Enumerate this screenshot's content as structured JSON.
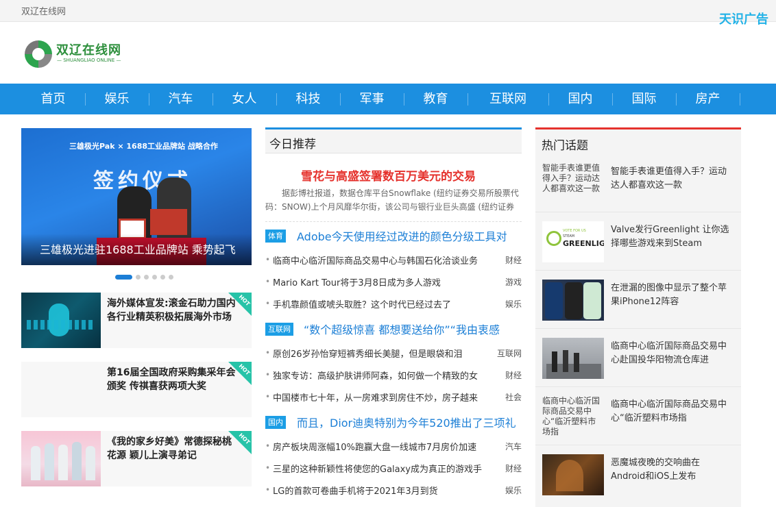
{
  "topbar": {
    "site_name": "双辽在线网",
    "ad_label": "天识广告"
  },
  "logo": {
    "name": "双辽在线网",
    "sub": "— SHUANGLIAO ONLINE —"
  },
  "nav": [
    "首页",
    "娱乐",
    "汽车",
    "女人",
    "科技",
    "军事",
    "教育",
    "互联网",
    "国内",
    "国际",
    "房产"
  ],
  "slider": {
    "caption": "三雄极光进驻1688工业品牌站 乘势起飞",
    "banner_text": "三雄极光Pak × 1688工业品牌站 战略合作",
    "banner_big": "签约仪式",
    "dot_count": 6,
    "active_dot": 0
  },
  "cards": [
    {
      "title": "海外媒体宣发:滚金石助力国内各行业精英积极拓展海外市场",
      "badge": "HOT"
    },
    {
      "title": "第16届全国政府采购集采年会颁奖 传祺喜获两项大奖",
      "badge": "HOT"
    },
    {
      "title": "《我的家乡好美》常德探秘桃花源 颖儿上演寻弟记",
      "badge": "HOT"
    }
  ],
  "today": {
    "heading": "今日推荐",
    "feature_title": "雪花与高盛签署数百万美元的交易",
    "feature_body": "据彭博社报道，数据仓库平台Snowflake (纽约证券交易所股票代码：SNOW)上个月风靡华尔街，该公司与银行业巨头高盛 (纽约证券"
  },
  "sections": [
    {
      "tag": "体育",
      "title": "Adobe今天使用经过改进的颜色分级工具对",
      "rows": [
        {
          "text": "临商中心临沂国际商品交易中心与韩国石化洽谈业务",
          "cat": "财经"
        },
        {
          "text": "Mario Kart Tour将于3月8日成为多人游戏",
          "cat": "游戏"
        },
        {
          "text": "手机靠颜值或唬头取胜？这个时代已经过去了",
          "cat": "娱乐"
        }
      ]
    },
    {
      "tag": "互联网",
      "title": "“数个超级惊喜 都想要送给你”“我由衷感",
      "rows": [
        {
          "text": "原创26岁孙怡穿短裤秀细长美腿，但是眼袋和泪",
          "cat": "互联网"
        },
        {
          "text": "独家专访：高级护肤讲师阿森，如何做一个精致的女",
          "cat": "财经"
        },
        {
          "text": "中国楼市七十年，从一房难求到房住不炒，房子越来",
          "cat": "社会"
        }
      ]
    },
    {
      "tag": "国内",
      "title": "而且，Dior迪奥特别为今年520推出了三项礼",
      "rows": [
        {
          "text": "房产板块周涨幅10%跑赢大盘一线城市7月房价加速",
          "cat": "汽车"
        },
        {
          "text": "三星的这种新颖性将使您的Galaxy成为真正的游戏手",
          "cat": "财经"
        },
        {
          "text": "LG的首款可卷曲手机将于2021年3月到货",
          "cat": "娱乐"
        }
      ]
    }
  ],
  "hot_topics": {
    "heading": "热门话题",
    "items": [
      {
        "title": "智能手表谁更值得入手？运动达人都喜欢这一款",
        "alt": "智能手表谁更值得入手？运动达人都喜欢这一款",
        "image": "broken"
      },
      {
        "title": "Valve发行Greenlight 让你选择哪些游戏来到Steam",
        "image": "greenlight-logo",
        "logo_small": "VOTE FOR US",
        "logo_mid": "STEAM",
        "logo_big": "GREENLIGHT"
      },
      {
        "title": "在泄漏的图像中显示了整个苹果iPhone12阵容",
        "image": "iphone-photo"
      },
      {
        "title": "临商中心临沂国际商品交易中心赴国投华阳物流仓库进",
        "image": "people-photo"
      },
      {
        "title": "临商中心临沂国际商品交易中心“临沂塑料市场指",
        "alt": "临商中心临沂国际商品交易中心“临沂塑料市场指",
        "image": "broken"
      },
      {
        "title": "恶魔城夜晚的交响曲在Android和iOS上发布",
        "image": "game-art"
      }
    ]
  }
}
